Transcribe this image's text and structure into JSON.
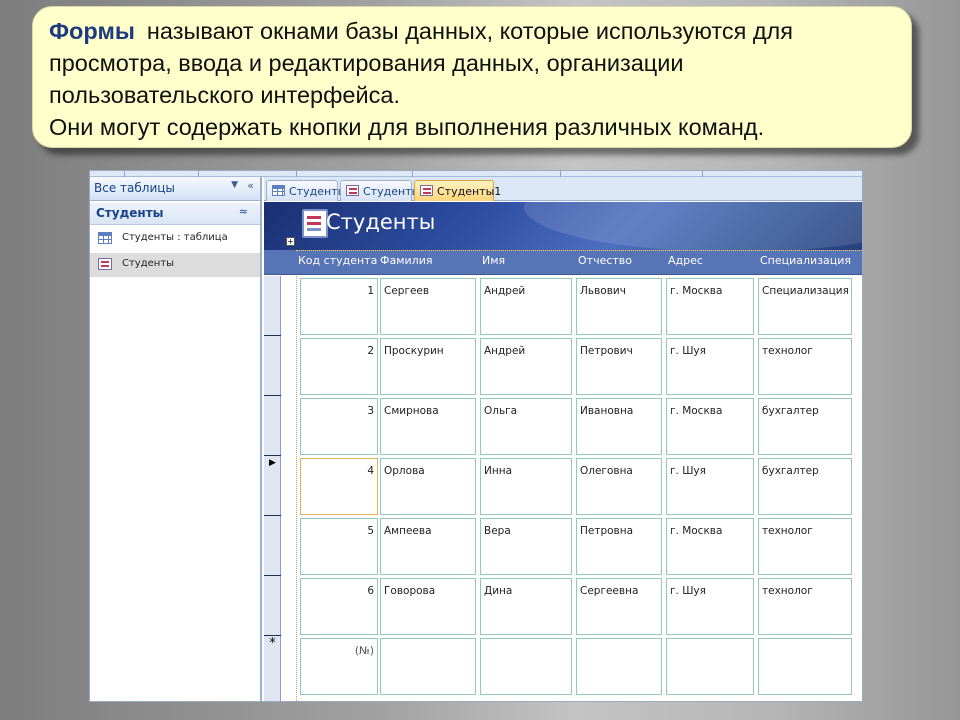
{
  "caption": {
    "highlight": "Формы",
    "line1_rest": "называют окнами базы данных, которые используются для",
    "line2": "просмотра, ввода и редактирования данных,  организации",
    "line3": "пользовательского интерфейса.",
    "line4": "Они могут содержать кнопки для выполнения различных команд."
  },
  "nav": {
    "header": "Все таблицы",
    "dropdown_glyph": "▼",
    "collapse_glyph": "«",
    "group": "Студенты",
    "group_collapse_glyph": "≈",
    "items": [
      {
        "label": "Студенты : таблица",
        "icon": "table-icon"
      },
      {
        "label": "Студенты",
        "icon": "form-icon",
        "selected": true
      }
    ]
  },
  "tabs": [
    {
      "label": "Студенты",
      "icon": "table-icon"
    },
    {
      "label": "Студенты",
      "icon": "form-icon"
    },
    {
      "label": "Студенты1",
      "icon": "form-icon",
      "active": true
    }
  ],
  "form": {
    "title": "Студенты",
    "columns": [
      "Код студента",
      "Фамилия",
      "Имя",
      "Отчество",
      "Адрес",
      "Специализация"
    ],
    "records": [
      [
        "1",
        "Сергеев",
        "Андрей",
        "Львович",
        "г. Москва",
        "Специализация"
      ],
      [
        "2",
        "Проскурин",
        "Андрей",
        "Петрович",
        "г. Шуя",
        "технолог"
      ],
      [
        "3",
        "Смирнова",
        "Ольга",
        "Ивановна",
        "г. Москва",
        "бухгалтер"
      ],
      [
        "4",
        "Орлова",
        "Инна",
        "Олеговна",
        "г. Шуя",
        "бухгалтер"
      ],
      [
        "5",
        "Ампеева",
        "Вера",
        "Петровна",
        "г. Москва",
        "технолог"
      ],
      [
        "6",
        "Говорова",
        "Дина",
        "Сергеевна",
        "г. Шуя",
        "технолог"
      ],
      [
        "(№)",
        "",
        "",
        "",
        "",
        ""
      ]
    ],
    "current_row_marker": "▶",
    "new_row_marker": "*"
  },
  "colors": {
    "caption_bg": "#ffffcc",
    "caption_highlight": "#1f3b80",
    "header_blue": "#2e4ea2",
    "column_bar": "#5774b6",
    "active_tab": "#ffd67a"
  }
}
